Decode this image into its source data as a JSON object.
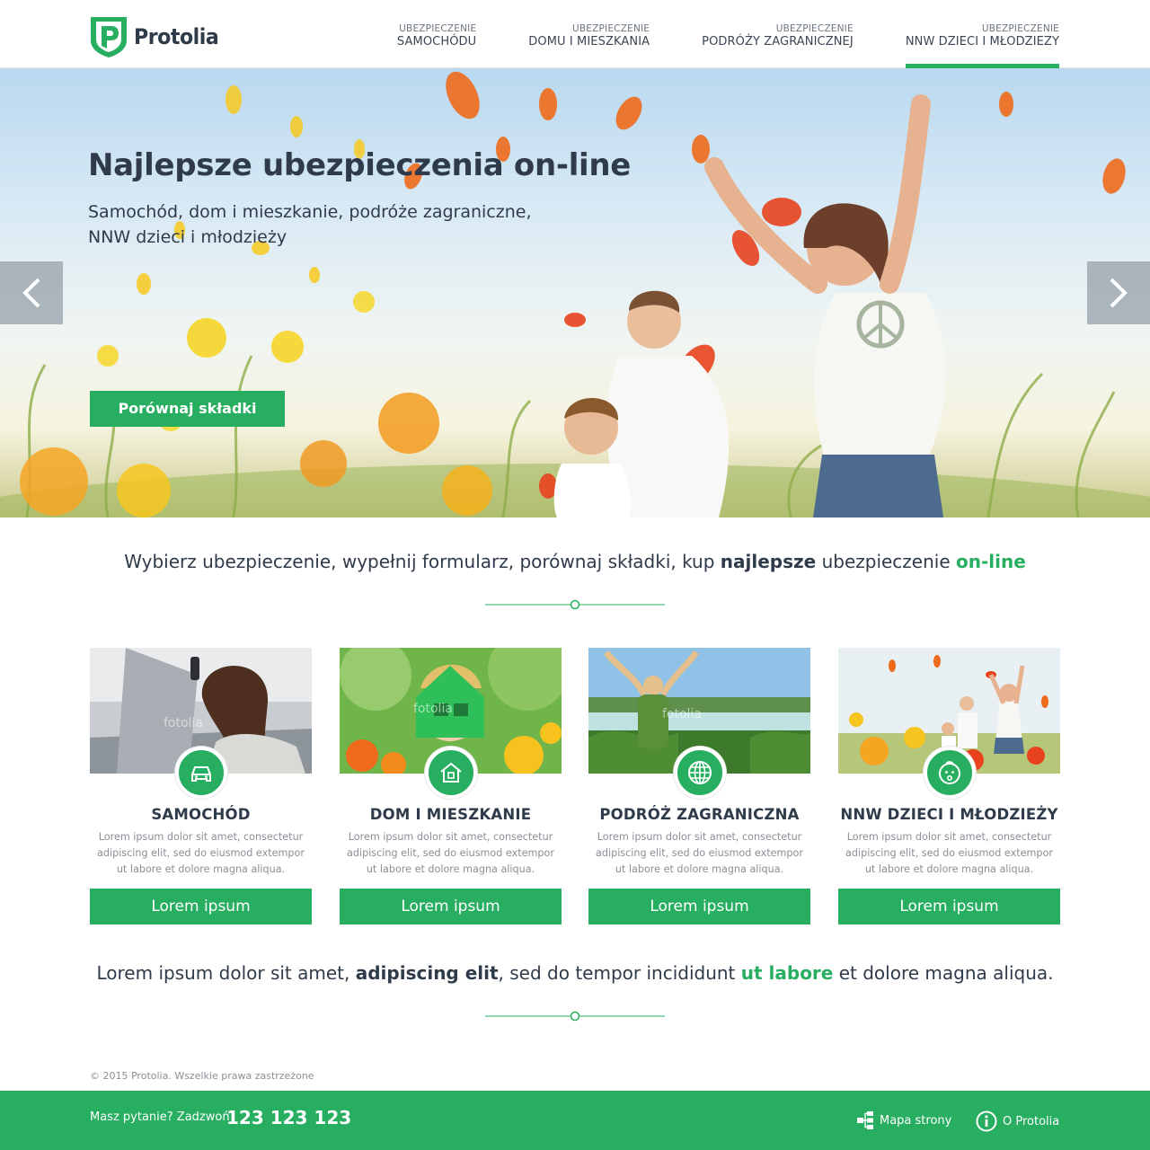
{
  "brand": {
    "name": "Protolia",
    "accent": "#27ae60",
    "text": "#2f3b4a"
  },
  "nav": {
    "items": [
      {
        "small": "UBEZPIECZENIE",
        "big": "SAMOCHÓDU"
      },
      {
        "small": "UBEZPIECZENIE",
        "big": "DOMU I MIESZKANIA"
      },
      {
        "small": "UBEZPIECZENIE",
        "big": "PODRÓŻY ZAGRANICZNEJ"
      },
      {
        "small": "UBEZPIECZENIE",
        "big": "NNW DZIECI I MŁODZIEZY"
      }
    ],
    "active_index": 3
  },
  "hero": {
    "title": "Najlepsze ubezpieczenia on-line",
    "subtitle": "Samochód, dom i mieszkanie, podróże zagraniczne, NNW dzieci i młodzieży",
    "button": "Porównaj składki",
    "prev_icon": "chevron-left-icon",
    "next_icon": "chevron-right-icon"
  },
  "intro": {
    "part1": "Wybierz ubezpieczenie, wypełnij formularz, porównaj składki, kup ",
    "bold": "najlepsze",
    "part2": " ubezpieczenie ",
    "green": "on-line"
  },
  "cards": [
    {
      "title": "SAMOCHÓD",
      "text": "Lorem ipsum dolor sit amet, consectetur adipiscing elit, sed do eiusmod extempor ut labore et dolore magna aliqua.",
      "button": "Lorem ipsum",
      "icon": "car-icon",
      "watermark": "fotolia"
    },
    {
      "title": "DOM I MIESZKANIE",
      "text": "Lorem ipsum dolor sit amet, consectetur adipiscing elit, sed do eiusmod extempor ut labore et dolore magna aliqua.",
      "button": "Lorem ipsum",
      "icon": "house-icon",
      "watermark": "fotolia"
    },
    {
      "title": "PODRÓŻ ZAGRANICZNA",
      "text": "Lorem ipsum dolor sit amet, consectetur adipiscing elit, sed do eiusmod extempor ut labore et dolore magna aliqua.",
      "button": "Lorem ipsum",
      "icon": "globe-icon",
      "watermark": "fotolia"
    },
    {
      "title": "NNW DZIECI I MŁODZIEŻY",
      "text": "Lorem ipsum dolor sit amet, consectetur adipiscing elit, sed do eiusmod extempor ut labore et dolore magna aliqua.",
      "button": "Lorem ipsum",
      "icon": "baby-face-icon"
    }
  ],
  "outro": {
    "part1": "Lorem ipsum dolor sit amet, ",
    "bold": "adipiscing elit",
    "part2": ", sed do tempor incididunt ",
    "green": "ut labore",
    "part3": " et dolore magna aliqua."
  },
  "footer": {
    "copyright": "© 2015 Protolia. Wszelkie prawa zastrzeżone",
    "ask": "Masz pytanie? Zadzwoń",
    "phone": "123 123 123",
    "sitemap": "Mapa strony",
    "about": "O Protolia"
  }
}
